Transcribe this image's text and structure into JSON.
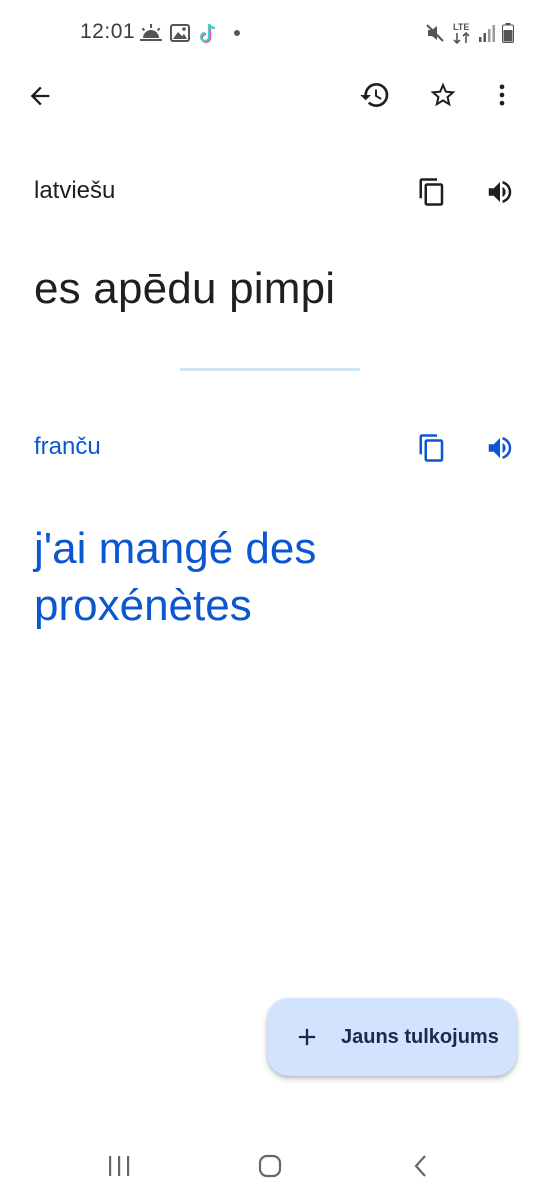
{
  "status_bar": {
    "time": "12:01",
    "network": "LTE",
    "icons_left": [
      "weather-sunrise-icon",
      "image-icon",
      "tiktok-icon",
      "notification-dot"
    ],
    "icons_right": [
      "mute-icon",
      "lte-icon",
      "signal-icon",
      "battery-icon"
    ]
  },
  "toolbar": {
    "back_icon": "back-arrow-icon",
    "history_icon": "history-icon",
    "favorite_icon": "star-outline-icon",
    "more_icon": "more-vert-icon"
  },
  "source": {
    "language": "latviešu",
    "text": "es apēdu pimpi"
  },
  "target": {
    "language": "franču",
    "text": "j'ai mangé des proxénètes"
  },
  "fab": {
    "label": "Jauns tulkojums",
    "icon": "plus-icon"
  },
  "colors": {
    "accent": "#0b57d0",
    "fab_background": "#d3e3fd",
    "divider": "#cfe4f3",
    "text_primary": "#1f1f1f"
  },
  "nav_bar": {
    "icons": [
      "recent-apps-icon",
      "home-icon",
      "back-chevron-icon"
    ]
  }
}
